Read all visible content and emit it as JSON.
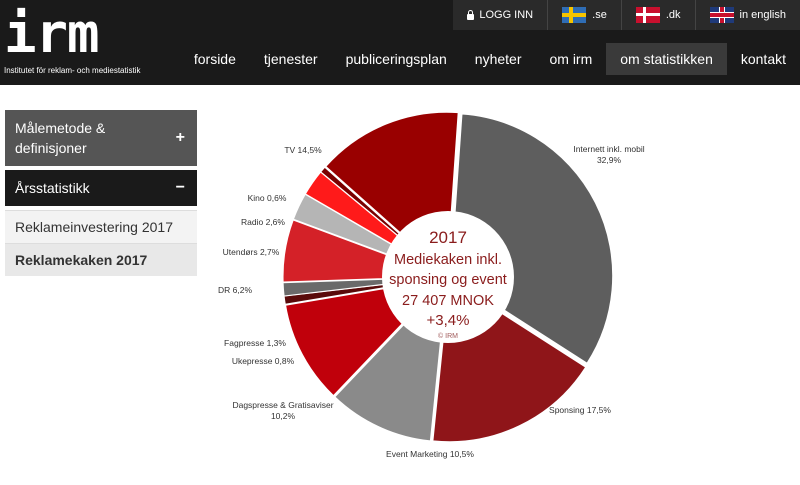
{
  "header": {
    "logo_text": "irm",
    "logo_subtitle": "Institutet för reklam- och mediestatistik",
    "topbar": [
      {
        "label": "LOGG INN",
        "icon": "lock-icon"
      },
      {
        "label": ".se",
        "icon": "sweden-flag-icon"
      },
      {
        "label": ".dk",
        "icon": "denmark-flag-icon"
      },
      {
        "label": "in english",
        "icon": "uk-flag-icon"
      }
    ],
    "nav": [
      {
        "label": "forside"
      },
      {
        "label": "tjenester"
      },
      {
        "label": "publiceringsplan"
      },
      {
        "label": "nyheter"
      },
      {
        "label": "om irm"
      },
      {
        "label": "om statistikken",
        "active": true
      },
      {
        "label": "kontakt"
      }
    ]
  },
  "sidebar": {
    "sections": [
      {
        "label": "Målemetode & definisjoner",
        "sign": "+"
      },
      {
        "label": "Årsstatistikk",
        "sign": "−"
      }
    ],
    "items": [
      {
        "label": "Reklameinvestering 2017"
      },
      {
        "label": "Reklamekaken 2017",
        "active": true
      }
    ]
  },
  "chart_data": {
    "type": "pie",
    "center_text": [
      "2017",
      "Mediekaken inkl.",
      "sponsing og event",
      "27 407 MNOK",
      "+3,4%",
      "© IRM"
    ],
    "slices": [
      {
        "label": "Internett inkl. mobil",
        "value_label": "32,9%",
        "value": 32.9,
        "color": "#5e5e5e"
      },
      {
        "label": "Sponsing",
        "value_label": "17,5%",
        "value": 17.5,
        "color": "#8f1519"
      },
      {
        "label": "Event Marketing",
        "value_label": "10,5%",
        "value": 10.5,
        "color": "#8a8a8a"
      },
      {
        "label": "Dagspresse & Gratisaviser",
        "value_label": "10,2%",
        "value": 10.2,
        "color": "#c0000b"
      },
      {
        "label": "Ukepresse",
        "value_label": "0,8%",
        "value": 0.8,
        "color": "#5a0a0a"
      },
      {
        "label": "Fagpresse",
        "value_label": "1,3%",
        "value": 1.3,
        "color": "#6a6a6a"
      },
      {
        "label": "DR",
        "value_label": "6,2%",
        "value": 6.2,
        "color": "#d42128"
      },
      {
        "label": "Utendørs",
        "value_label": "2,7%",
        "value": 2.7,
        "color": "#b5b5b5"
      },
      {
        "label": "Radio",
        "value_label": "2,6%",
        "value": 2.6,
        "color": "#ff1a1a"
      },
      {
        "label": "Kino",
        "value_label": "0,6%",
        "value": 0.6,
        "color": "#7a0000"
      },
      {
        "label": "TV",
        "value_label": "14,5%",
        "value": 14.5,
        "color": "#990000"
      }
    ]
  }
}
